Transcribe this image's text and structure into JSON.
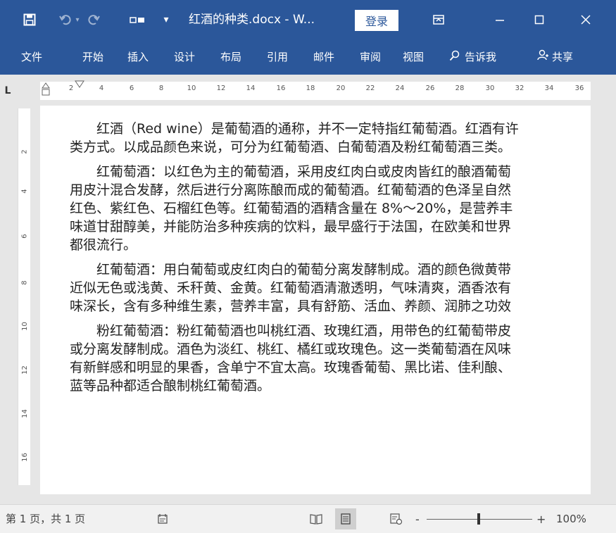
{
  "titlebar": {
    "doc_title": "红酒的种类.docx - W...",
    "login_label": "登录",
    "icons": [
      "save-icon",
      "undo-icon",
      "redo-icon",
      "touch-mode-icon",
      "customize-qat-icon",
      "ribbon-display-options-icon",
      "minimize-icon",
      "maximize-icon",
      "close-icon"
    ],
    "bg": "#2b579a"
  },
  "ribbon": {
    "tabs": [
      "文件",
      "开始",
      "插入",
      "设计",
      "布局",
      "引用",
      "邮件",
      "审阅",
      "视图"
    ],
    "tell_me": "告诉我",
    "share": "共享"
  },
  "ruler": {
    "corner": "L",
    "h_ticks": [
      "2",
      "4",
      "6",
      "8",
      "10",
      "12",
      "14",
      "16",
      "18",
      "20",
      "22",
      "24",
      "26",
      "28",
      "30",
      "32",
      "34",
      "36"
    ],
    "v_ticks": [
      "2",
      "4",
      "6",
      "8",
      "10",
      "12",
      "14",
      "16"
    ]
  },
  "document": {
    "paragraphs": [
      [
        "红酒（Red wine）是葡萄酒的通称，并不一定特指红葡萄酒。红酒有许",
        "类方式。以成品颜色来说，可分为红葡萄酒、白葡萄酒及粉红葡萄酒三类。"
      ],
      [
        "红葡萄酒：以红色为主的葡萄酒，采用皮红肉白或皮肉皆红的酿酒葡萄",
        "用皮汁混合发酵，然后进行分离陈酿而成的葡萄酒。红葡萄酒的色泽呈自然",
        "红色、紫红色、石榴红色等。红葡萄酒的酒精含量在 8%～20%，是营养丰",
        "味道甘甜醇美，并能防治多种疾病的饮料，最早盛行于法国，在欧美和世界",
        "都很流行。"
      ],
      [
        "红葡萄酒：用白葡萄或皮红肉白的葡萄分离发酵制成。酒的颜色微黄带",
        "近似无色或浅黄、禾秆黄、金黄。红葡萄酒清澈透明，气味清爽，酒香浓有",
        "味深长，含有多种维生素，营养丰富，具有舒筋、活血、养颜、润肺之功效"
      ],
      [
        "粉红葡萄酒：粉红葡萄酒也叫桃红酒、玫瑰红酒，用带色的红葡萄带皮",
        "或分离发酵制成。酒色为淡红、桃红、橘红或玫瑰色。这一类葡萄酒在风味",
        "有新鲜感和明显的果香，含单宁不宜太高。玫瑰香葡萄、黑比诺、佳利酿、",
        "蓝等品种都适合酿制桃红葡萄酒。"
      ]
    ]
  },
  "statusbar": {
    "page_info": "第 1 页，共 1 页",
    "zoom_minus": "-",
    "zoom_plus": "+",
    "zoom_level": "100%",
    "zoom_fraction": 0.48
  }
}
